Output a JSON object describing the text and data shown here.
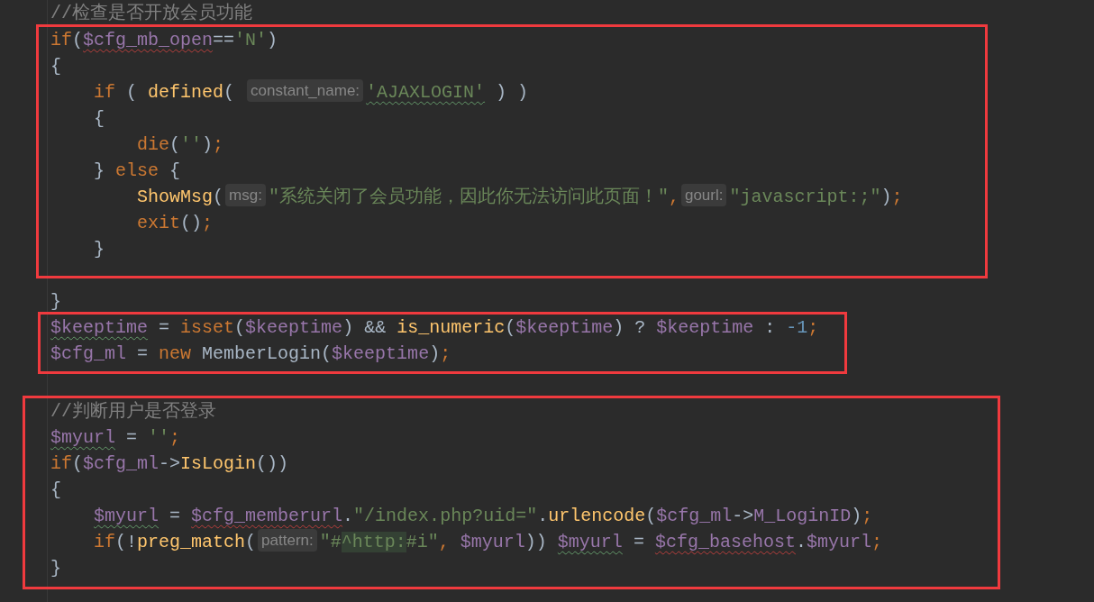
{
  "sections": [
    {
      "boxed": false,
      "lines": [
        {
          "tokens": [
            {
              "kind": "comment",
              "text": "//检查是否开放会员功能"
            }
          ]
        }
      ]
    },
    {
      "boxed": true,
      "lines": [
        {
          "tokens": [
            {
              "kind": "keyword",
              "text": "if"
            },
            {
              "kind": "plain",
              "text": "("
            },
            {
              "kind": "var",
              "text": "$cfg_mb_open",
              "error": true
            },
            {
              "kind": "plain",
              "text": "=="
            },
            {
              "kind": "string",
              "text": "'N'"
            },
            {
              "kind": "plain",
              "text": ")"
            }
          ]
        },
        {
          "tokens": [
            {
              "kind": "plain",
              "text": "{"
            }
          ]
        },
        {
          "tokens": [
            {
              "kind": "keyword",
              "text": "    if"
            },
            {
              "kind": "plain",
              "text": " ( "
            },
            {
              "kind": "func",
              "text": "defined"
            },
            {
              "kind": "plain",
              "text": "( "
            },
            {
              "kind": "hint",
              "text": "constant_name:"
            },
            {
              "kind": "string",
              "text": "'AJAXLOGIN'",
              "typo": true
            },
            {
              "kind": "plain",
              "text": " ) )"
            }
          ]
        },
        {
          "tokens": [
            {
              "kind": "plain",
              "text": "    {"
            }
          ]
        },
        {
          "tokens": [
            {
              "kind": "keyword",
              "text": "        die"
            },
            {
              "kind": "plain",
              "text": "("
            },
            {
              "kind": "string",
              "text": "''"
            },
            {
              "kind": "plain",
              "text": ")"
            },
            {
              "kind": "keyword",
              "text": ";"
            }
          ]
        },
        {
          "tokens": [
            {
              "kind": "plain",
              "text": "    } "
            },
            {
              "kind": "keyword",
              "text": "else"
            },
            {
              "kind": "plain",
              "text": " {"
            }
          ]
        },
        {
          "tokens": [
            {
              "kind": "func",
              "text": "        ShowMsg"
            },
            {
              "kind": "plain",
              "text": "("
            },
            {
              "kind": "hint",
              "text": "msg:"
            },
            {
              "kind": "string",
              "text": "\"系统关闭了会员功能，因此你无法访问此页面！\""
            },
            {
              "kind": "keyword",
              "text": ","
            },
            {
              "kind": "hint",
              "text": "gourl:"
            },
            {
              "kind": "string",
              "text": "\"javascript:;\""
            },
            {
              "kind": "plain",
              "text": ")"
            },
            {
              "kind": "keyword",
              "text": ";"
            }
          ]
        },
        {
          "tokens": [
            {
              "kind": "keyword",
              "text": "        exit"
            },
            {
              "kind": "plain",
              "text": "()"
            },
            {
              "kind": "keyword",
              "text": ";"
            }
          ]
        },
        {
          "tokens": [
            {
              "kind": "plain",
              "text": "    }"
            }
          ]
        }
      ]
    },
    {
      "boxed": false,
      "lines": [
        {
          "tokens": [
            {
              "kind": "plain",
              "text": "}"
            }
          ]
        }
      ]
    },
    {
      "boxed": true,
      "lines": [
        {
          "tokens": [
            {
              "kind": "var",
              "text": "$keeptime",
              "typo": true
            },
            {
              "kind": "plain",
              "text": " = "
            },
            {
              "kind": "keyword",
              "text": "isset"
            },
            {
              "kind": "plain",
              "text": "("
            },
            {
              "kind": "var",
              "text": "$keeptime"
            },
            {
              "kind": "plain",
              "text": ") && "
            },
            {
              "kind": "func",
              "text": "is_numeric"
            },
            {
              "kind": "plain",
              "text": "("
            },
            {
              "kind": "var",
              "text": "$keeptime"
            },
            {
              "kind": "plain",
              "text": ") ? "
            },
            {
              "kind": "var",
              "text": "$keeptime"
            },
            {
              "kind": "plain",
              "text": " : "
            },
            {
              "kind": "number",
              "text": "-1"
            },
            {
              "kind": "keyword",
              "text": ";"
            }
          ]
        },
        {
          "tokens": [
            {
              "kind": "var",
              "text": "$cfg_ml"
            },
            {
              "kind": "plain",
              "text": " = "
            },
            {
              "kind": "keyword",
              "text": "new"
            },
            {
              "kind": "plain",
              "text": " MemberLogin("
            },
            {
              "kind": "var",
              "text": "$keeptime"
            },
            {
              "kind": "plain",
              "text": ")"
            },
            {
              "kind": "keyword",
              "text": ";"
            }
          ]
        }
      ]
    },
    {
      "boxed": true,
      "lines": [
        {
          "tokens": [
            {
              "kind": "comment",
              "text": "//判断用户是否登录"
            }
          ]
        },
        {
          "tokens": [
            {
              "kind": "var",
              "text": "$myurl",
              "typo": true
            },
            {
              "kind": "plain",
              "text": " = "
            },
            {
              "kind": "string",
              "text": "''"
            },
            {
              "kind": "keyword",
              "text": ";"
            }
          ]
        },
        {
          "tokens": [
            {
              "kind": "keyword",
              "text": "if"
            },
            {
              "kind": "plain",
              "text": "("
            },
            {
              "kind": "var",
              "text": "$cfg_ml"
            },
            {
              "kind": "plain",
              "text": "->"
            },
            {
              "kind": "func",
              "text": "IsLogin"
            },
            {
              "kind": "plain",
              "text": "())"
            }
          ]
        },
        {
          "tokens": [
            {
              "kind": "plain",
              "text": "{"
            }
          ]
        },
        {
          "tokens": [
            {
              "kind": "var",
              "text": "    $myurl",
              "typo": true
            },
            {
              "kind": "plain",
              "text": " = "
            },
            {
              "kind": "var",
              "text": "$cfg_memberurl",
              "error": true
            },
            {
              "kind": "plain",
              "text": "."
            },
            {
              "kind": "string",
              "text": "\"/index.php?uid=\""
            },
            {
              "kind": "plain",
              "text": "."
            },
            {
              "kind": "func",
              "text": "urlencode"
            },
            {
              "kind": "plain",
              "text": "("
            },
            {
              "kind": "var",
              "text": "$cfg_ml"
            },
            {
              "kind": "plain",
              "text": "->"
            },
            {
              "kind": "var",
              "text": "M_LoginID"
            },
            {
              "kind": "plain",
              "text": ")"
            },
            {
              "kind": "keyword",
              "text": ";"
            }
          ]
        },
        {
          "tokens": [
            {
              "kind": "keyword",
              "text": "    if"
            },
            {
              "kind": "plain",
              "text": "(!"
            },
            {
              "kind": "func",
              "text": "preg_match"
            },
            {
              "kind": "plain",
              "text": "("
            },
            {
              "kind": "hint",
              "text": "pattern:"
            },
            {
              "kind": "string",
              "text": "\"#"
            },
            {
              "kind": "regex",
              "text": "^http:"
            },
            {
              "kind": "string",
              "text": "#i\""
            },
            {
              "kind": "keyword",
              "text": ", "
            },
            {
              "kind": "var",
              "text": "$myurl"
            },
            {
              "kind": "plain",
              "text": ")) "
            },
            {
              "kind": "var",
              "text": "$myurl",
              "typo": true
            },
            {
              "kind": "plain",
              "text": " = "
            },
            {
              "kind": "var",
              "text": "$cfg_basehost",
              "error": true
            },
            {
              "kind": "plain",
              "text": "."
            },
            {
              "kind": "var",
              "text": "$myurl"
            },
            {
              "kind": "keyword",
              "text": ";"
            }
          ]
        },
        {
          "tokens": [
            {
              "kind": "plain",
              "text": "}"
            }
          ]
        }
      ]
    }
  ]
}
